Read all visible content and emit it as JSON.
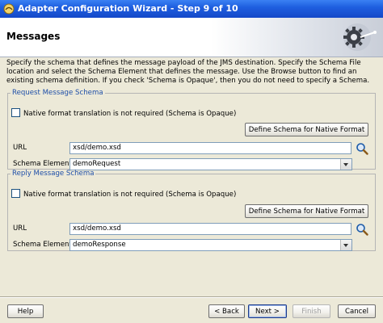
{
  "window": {
    "title": "Adapter Configuration Wizard - Step 9 of 10"
  },
  "page": {
    "title": "Messages",
    "description": "Specify the schema that defines the message payload of the JMS destination.  Specify the Schema File location and select the Schema Element that defines the message. Use the Browse button to find an existing schema definition. If you check 'Schema is Opaque', then you do not need to specify a Schema."
  },
  "request": {
    "legend": "Request Message Schema",
    "checkbox_label": "Native format translation is not required (Schema is Opaque)",
    "define_button": "Define Schema for Native Format",
    "url_label": "URL",
    "url_value": "xsd/demo.xsd",
    "element_label": "Schema Element",
    "element_value": "demoRequest"
  },
  "reply": {
    "legend": "Reply Message Schema",
    "checkbox_label": "Native format translation is not required (Schema is Opaque)",
    "define_button": "Define Schema for Native Format",
    "url_label": "URL",
    "url_value": "xsd/demo.xsd",
    "element_label": "Schema Element",
    "element_value": "demoResponse"
  },
  "footer": {
    "help": "Help",
    "back": "< Back",
    "next": "Next >",
    "finish": "Finish",
    "cancel": "Cancel"
  },
  "icons": {
    "app": "oracle-jdeveloper-icon",
    "logo": "gear-wizard-icon",
    "browse": "magnifier-icon"
  },
  "colors": {
    "titlebar": "#1f5fe0",
    "legend": "#1f4fa8",
    "face": "#ece9d8"
  }
}
